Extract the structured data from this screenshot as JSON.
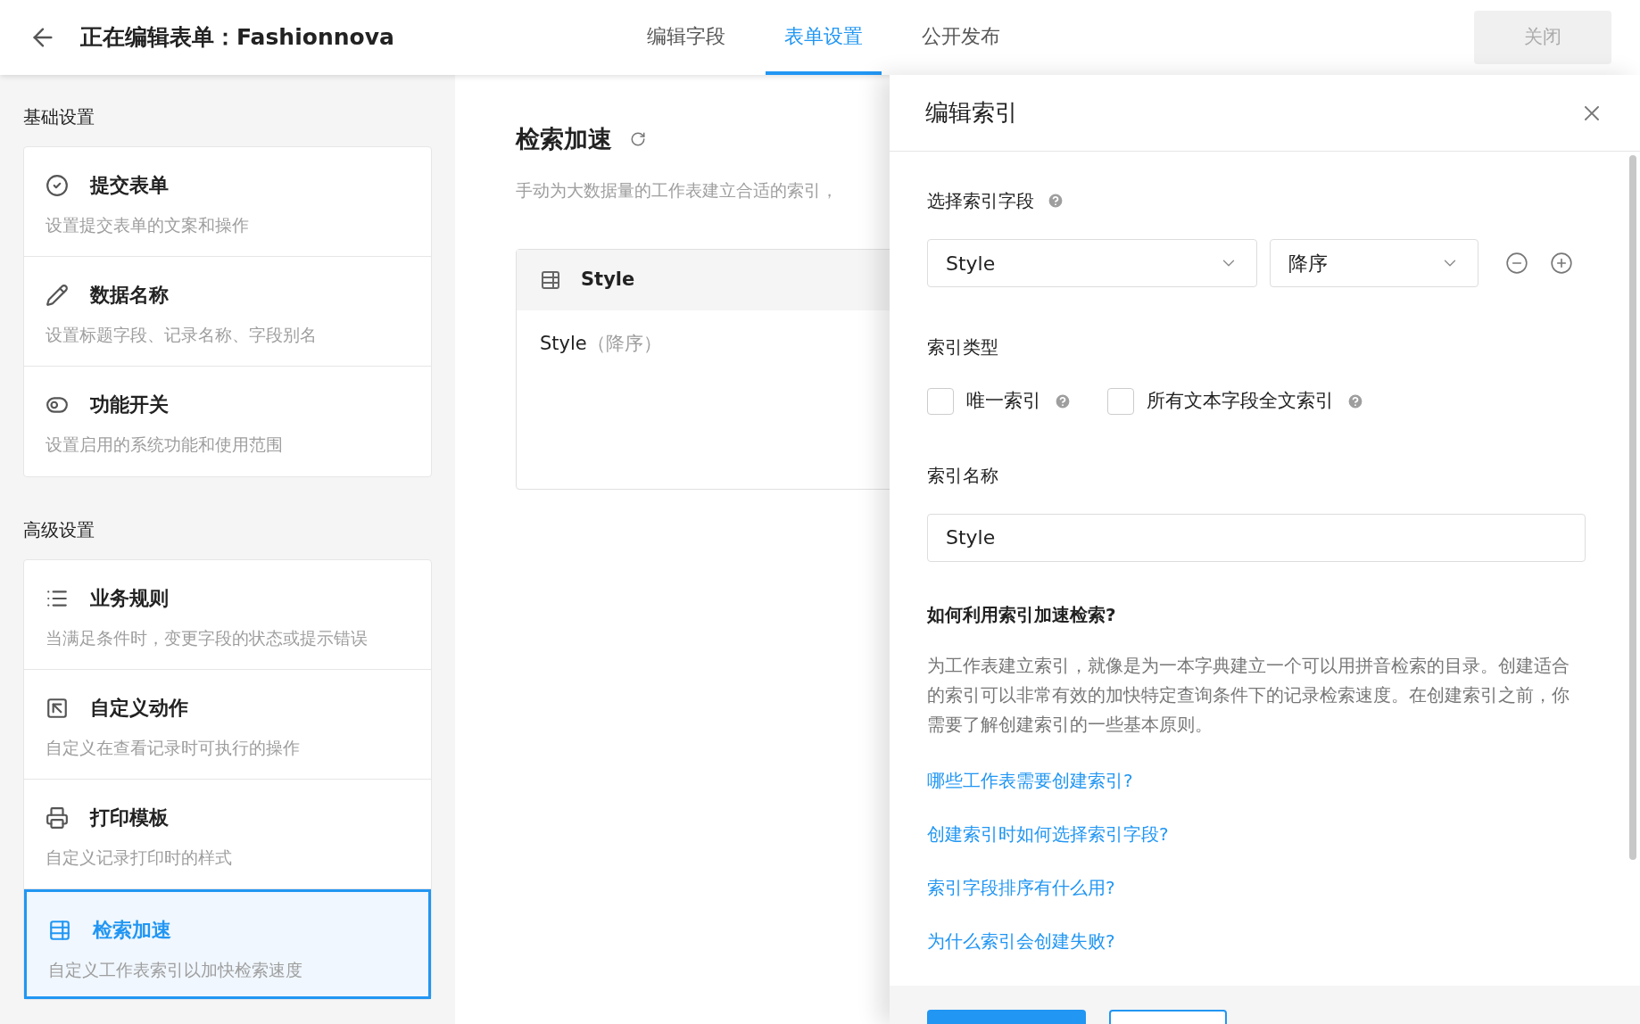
{
  "header": {
    "title": "正在编辑表单：Fashionnova",
    "close_button": {
      "label": "关闭",
      "disabled": true
    },
    "tabs": [
      {
        "label": "编辑字段",
        "selected": false
      },
      {
        "label": "表单设置",
        "selected": true
      },
      {
        "label": "公开发布",
        "selected": false
      }
    ]
  },
  "sidebar": {
    "sections": [
      {
        "title": "基础设置",
        "items": [
          {
            "title": "提交表单",
            "subtitle": "设置提交表单的文案和操作",
            "selected": false
          },
          {
            "title": "数据名称",
            "subtitle": "设置标题字段、记录名称、字段别名",
            "selected": false
          },
          {
            "title": "功能开关",
            "subtitle": "设置启用的系统功能和使用范围",
            "selected": false
          }
        ]
      },
      {
        "title": "高级设置",
        "items": [
          {
            "title": "业务规则",
            "subtitle": "当满足条件时，变更字段的状态或提示错误",
            "selected": false
          },
          {
            "title": "自定义动作",
            "subtitle": "自定义在查看记录时可执行的操作",
            "selected": false
          },
          {
            "title": "打印模板",
            "subtitle": "自定义记录打印时的样式",
            "selected": false
          },
          {
            "title": "检索加速",
            "subtitle": "自定义工作表索引以加快检索速度",
            "selected": true
          }
        ]
      }
    ]
  },
  "main": {
    "title": "检索加速",
    "description": "手动为大数据量的工作表建立合适的索引，",
    "index_card": {
      "name": "Style",
      "field": "Style",
      "order": "（降序）"
    }
  },
  "drawer": {
    "title": "编辑索引",
    "field_label": "选择索引字段",
    "field_select": "Style",
    "order_select": "降序",
    "type_label": "索引类型",
    "options": [
      {
        "label": "唯一索引",
        "checked": false
      },
      {
        "label": "所有文本字段全文索引",
        "checked": false
      }
    ],
    "name_label": "索引名称",
    "name_value": "Style",
    "help_title": "如何利用索引加速检索?",
    "help_text": "为工作表建立索引，就像是为一本字典建立一个可以用拼音检索的目录。创建适合的索引可以非常有效的加快特定查询条件下的记录检索速度。在创建索引之前，你需要了解创建索引的一些基本原则。",
    "links": [
      "哪些工作表需要创建索引?",
      "创建索引时如何选择索引字段?",
      "索引字段排序有什么用?",
      "为什么索引会创建失败?"
    ]
  }
}
